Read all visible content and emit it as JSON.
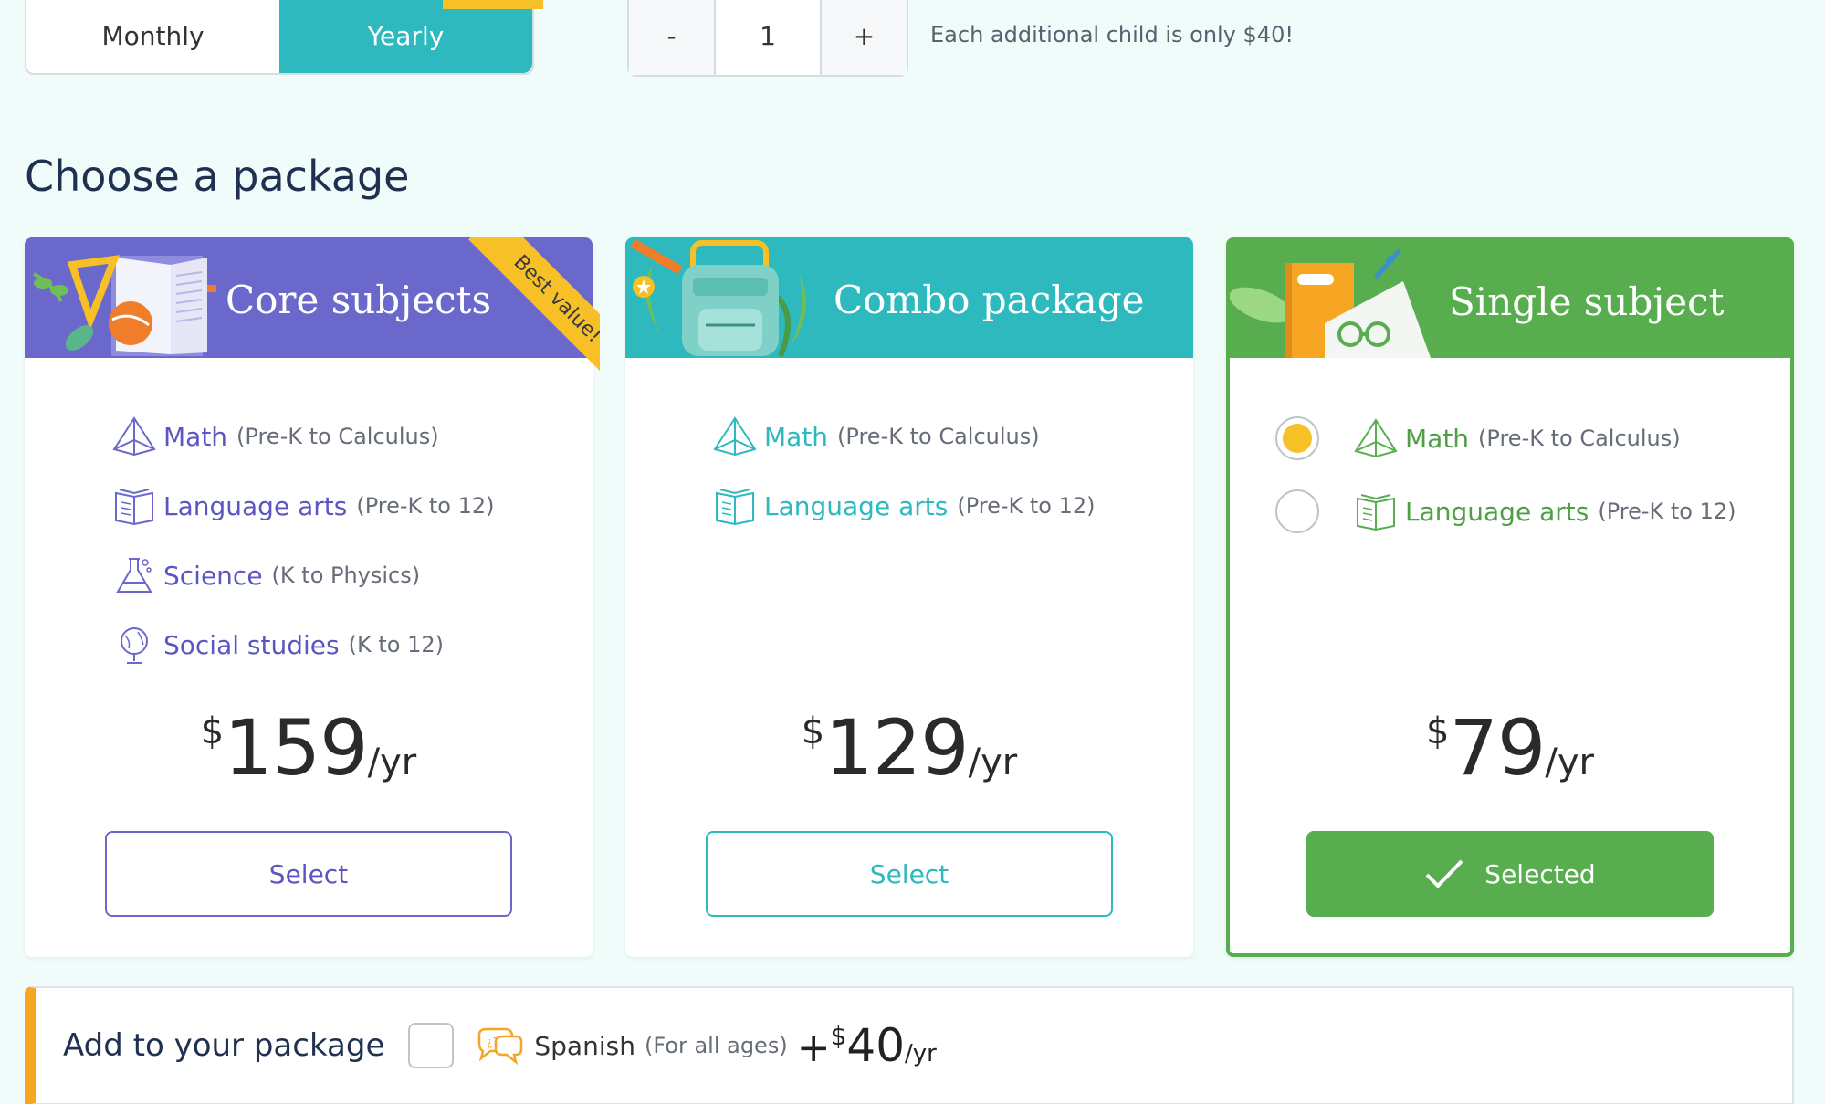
{
  "billing": {
    "monthly_label": "Monthly",
    "yearly_label": "Yearly",
    "selected": "Yearly"
  },
  "children": {
    "minus_label": "-",
    "count": "1",
    "plus_label": "+",
    "note": "Each additional child is only $40!"
  },
  "section_title": "Choose a package",
  "packages": [
    {
      "title": "Core subjects",
      "badge": "Best value!",
      "color": "#6b68cc",
      "subjects": [
        {
          "name": "Math",
          "range": "(Pre-K to Calculus)",
          "icon": "pyramid-icon"
        },
        {
          "name": "Language arts",
          "range": "(Pre-K to 12)",
          "icon": "book-icon"
        },
        {
          "name": "Science",
          "range": "(K to Physics)",
          "icon": "flask-icon"
        },
        {
          "name": "Social studies",
          "range": "(K to 12)",
          "icon": "globe-icon"
        }
      ],
      "price_currency": "$",
      "price_amount": "159",
      "price_period": "/yr",
      "button_label": "Select"
    },
    {
      "title": "Combo package",
      "color": "#2db9bd",
      "subjects": [
        {
          "name": "Math",
          "range": "(Pre-K to Calculus)",
          "icon": "pyramid-icon"
        },
        {
          "name": "Language arts",
          "range": "(Pre-K to 12)",
          "icon": "book-icon"
        }
      ],
      "price_currency": "$",
      "price_amount": "129",
      "price_period": "/yr",
      "button_label": "Select"
    },
    {
      "title": "Single subject",
      "color": "#58ae4e",
      "subjects": [
        {
          "name": "Math",
          "range": "(Pre-K to Calculus)",
          "icon": "pyramid-icon",
          "checked": true
        },
        {
          "name": "Language arts",
          "range": "(Pre-K to 12)",
          "icon": "book-icon",
          "checked": false
        }
      ],
      "price_currency": "$",
      "price_amount": "79",
      "price_period": "/yr",
      "button_label": "Selected"
    }
  ],
  "addon": {
    "label": "Add to your package",
    "name": "Spanish",
    "range": "(For all ages)",
    "price_plus": "+",
    "price_currency": "$",
    "price_amount": "40",
    "price_period": "/yr",
    "accent": "#f6a623"
  }
}
